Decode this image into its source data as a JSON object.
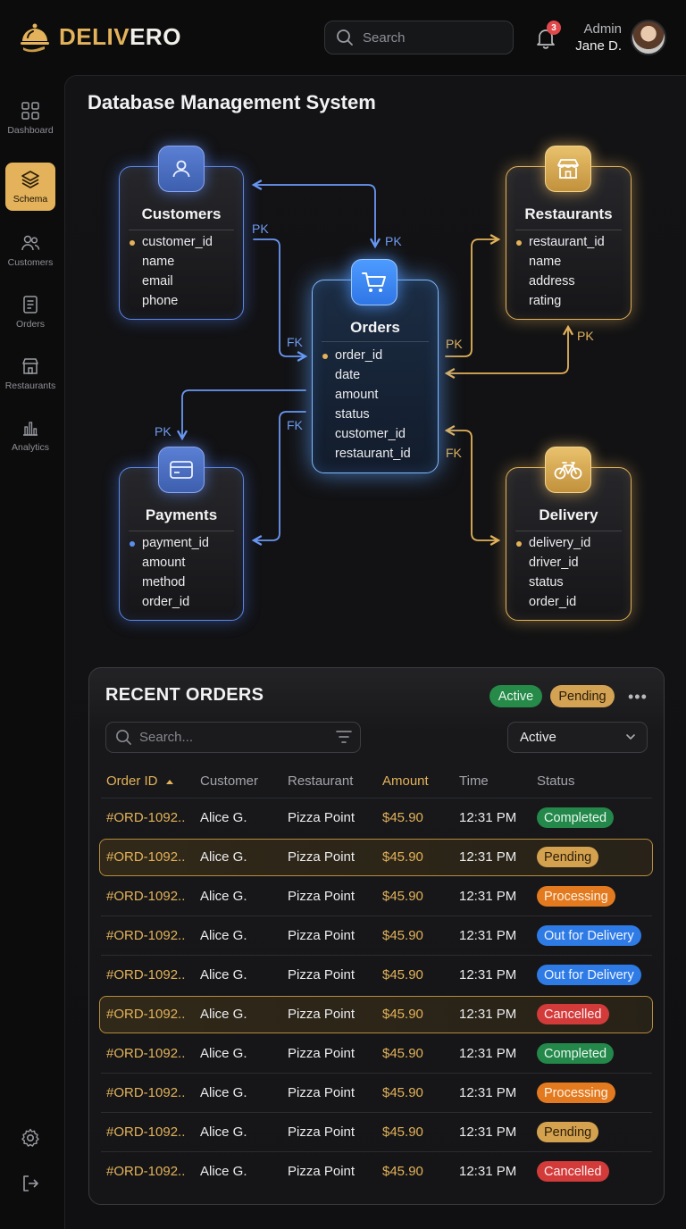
{
  "brand": {
    "name_part1": "DELIV",
    "name_part2": "ERO"
  },
  "search": {
    "placeholder": "Search"
  },
  "notifications": {
    "count": "3"
  },
  "user": {
    "role": "Admin",
    "name": "Jane D."
  },
  "sidebar": {
    "items": [
      {
        "label": "Dashboard",
        "icon": "grid-icon"
      },
      {
        "label": "Schema",
        "icon": "layers-icon",
        "active": true
      },
      {
        "label": "Customers",
        "icon": "users-icon"
      },
      {
        "label": "Orders",
        "icon": "document-icon"
      },
      {
        "label": "Restaurants",
        "icon": "storefront-icon"
      },
      {
        "label": "Analytics",
        "icon": "bar-chart-icon"
      }
    ],
    "bottom_icons": [
      "gear-icon",
      "logout-icon"
    ]
  },
  "page": {
    "title": "Database Management System"
  },
  "schema": {
    "customers": {
      "title": "Customers",
      "fields": [
        "customer_id",
        "name",
        "email",
        "phone"
      ]
    },
    "orders": {
      "title": "Orders",
      "fields": [
        "order_id",
        "date",
        "amount",
        "status",
        "customer_id",
        "restaurant_id"
      ]
    },
    "restaurants": {
      "title": "Restaurants",
      "fields": [
        "restaurant_id",
        "name",
        "address",
        "rating"
      ]
    },
    "payments": {
      "title": "Payments",
      "fields": [
        "payment_id",
        "amount",
        "method",
        "order_id"
      ]
    },
    "delivery": {
      "title": "Delivery",
      "fields": [
        "delivery_id",
        "driver_id",
        "status",
        "order_id"
      ]
    },
    "keys": {
      "pk": "PK",
      "fk": "FK"
    }
  },
  "recent_orders": {
    "title": "RECENT ORDERS",
    "chips": {
      "active": "Active",
      "pending": "Pending"
    },
    "more": "•••",
    "search_placeholder": "Search...",
    "filter_value": "Active",
    "columns": [
      "Order ID",
      "Customer",
      "Restaurant",
      "Amount",
      "Time",
      "Status"
    ],
    "rows": [
      {
        "id": "#ORD-1092..",
        "customer": "Alice G.",
        "restaurant": "Pizza Point",
        "amount": "$45.90",
        "time": "12:31 PM",
        "status": "Completed",
        "kind": "completed",
        "highlight": false
      },
      {
        "id": "#ORD-1092..",
        "customer": "Alice G.",
        "restaurant": "Pizza Point",
        "amount": "$45.90",
        "time": "12:31 PM",
        "status": "Pending",
        "kind": "pending",
        "highlight": true
      },
      {
        "id": "#ORD-1092..",
        "customer": "Alice G.",
        "restaurant": "Pizza Point",
        "amount": "$45.90",
        "time": "12:31 PM",
        "status": "Processing",
        "kind": "processing",
        "highlight": false
      },
      {
        "id": "#ORD-1092..",
        "customer": "Alice G.",
        "restaurant": "Pizza Point",
        "amount": "$45.90",
        "time": "12:31 PM",
        "status": "Out for Delivery",
        "kind": "delivery",
        "highlight": false
      },
      {
        "id": "#ORD-1092..",
        "customer": "Alice G.",
        "restaurant": "Pizza Point",
        "amount": "$45.90",
        "time": "12:31 PM",
        "status": "Out for Delivery",
        "kind": "delivery",
        "highlight": false
      },
      {
        "id": "#ORD-1092..",
        "customer": "Alice G.",
        "restaurant": "Pizza Point",
        "amount": "$45.90",
        "time": "12:31 PM",
        "status": "Cancelled",
        "kind": "cancelled",
        "highlight": true
      },
      {
        "id": "#ORD-1092..",
        "customer": "Alice G.",
        "restaurant": "Pizza Point",
        "amount": "$45.90",
        "time": "12:31 PM",
        "status": "Completed",
        "kind": "completed",
        "highlight": false
      },
      {
        "id": "#ORD-1092..",
        "customer": "Alice G.",
        "restaurant": "Pizza Point",
        "amount": "$45.90",
        "time": "12:31 PM",
        "status": "Processing",
        "kind": "processing",
        "highlight": false
      },
      {
        "id": "#ORD-1092..",
        "customer": "Alice G.",
        "restaurant": "Pizza Point",
        "amount": "$45.90",
        "time": "12:31 PM",
        "status": "Pending",
        "kind": "pending",
        "highlight": false
      },
      {
        "id": "#ORD-1092..",
        "customer": "Alice G.",
        "restaurant": "Pizza Point",
        "amount": "$45.90",
        "time": "12:31 PM",
        "status": "Cancelled",
        "kind": "cancelled",
        "highlight": false
      }
    ]
  },
  "colors": {
    "accent": "#e3b25a",
    "blue": "#5b87e6",
    "background": "#0c0c0d"
  }
}
